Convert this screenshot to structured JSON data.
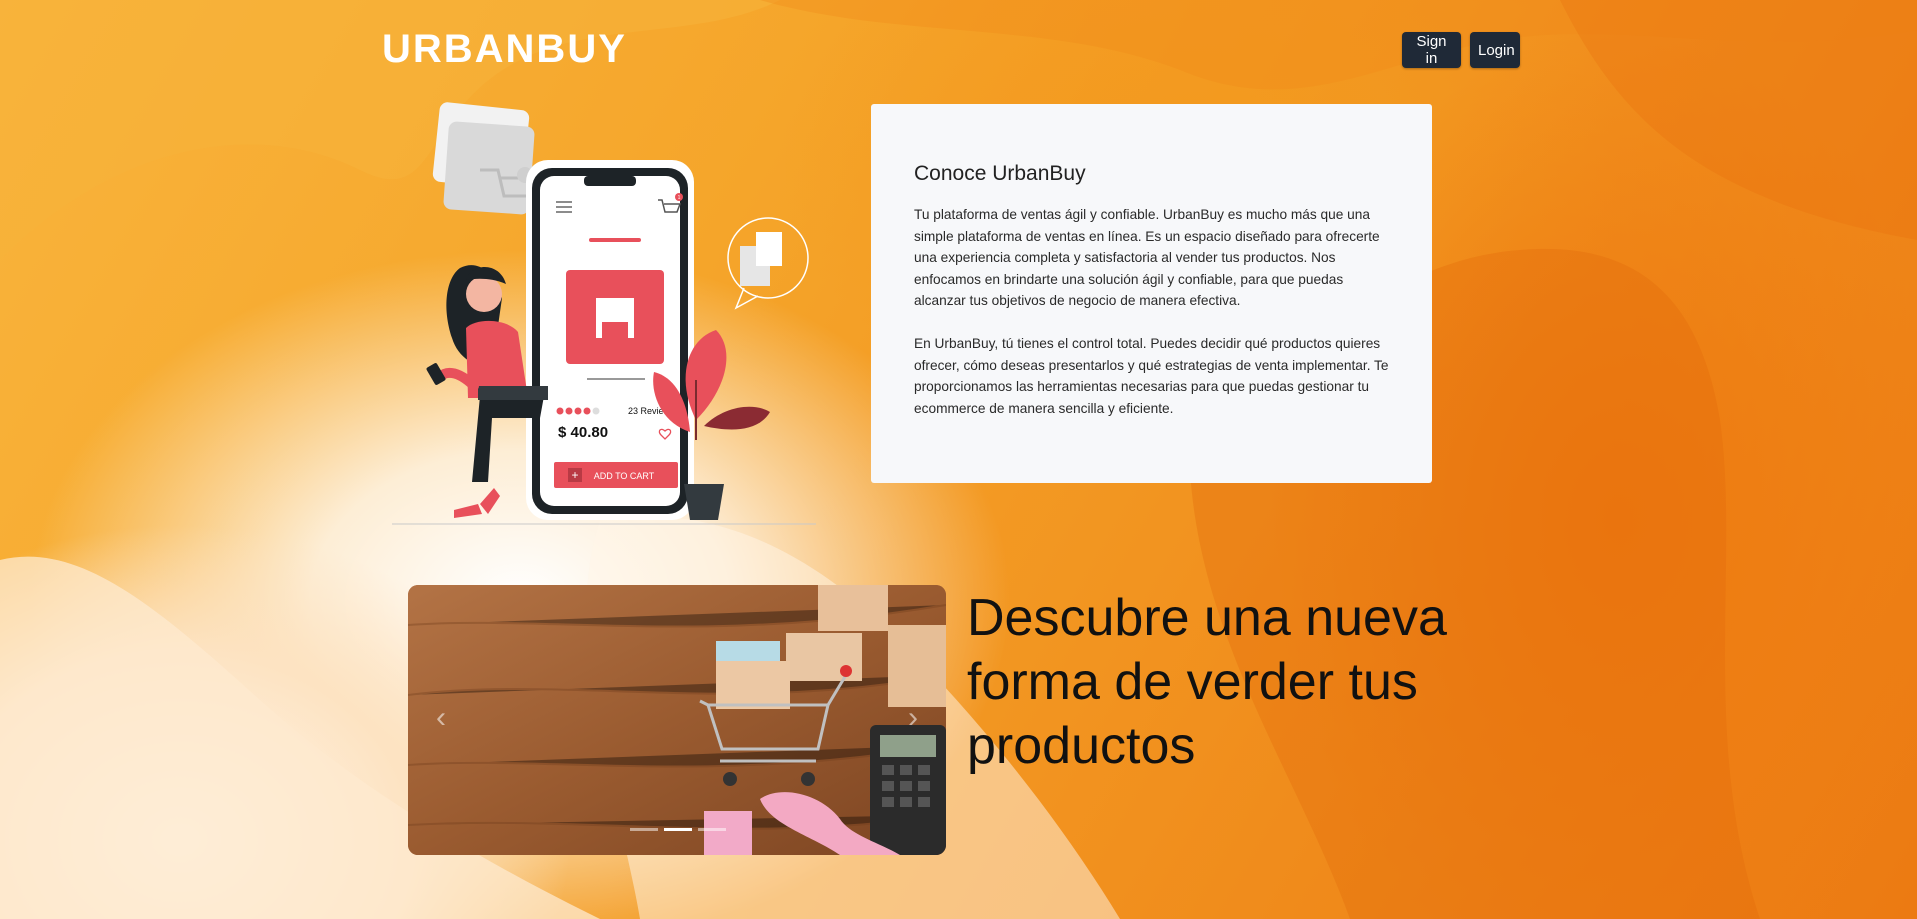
{
  "brand": {
    "logo_text": "URBANBUY"
  },
  "header": {
    "signin_label": "Sign in",
    "login_label": "Login"
  },
  "illustration": {
    "reviews_text": "23 Reviews",
    "price": "$ 40.80",
    "add_to_cart_label": "ADD TO CART",
    "cart_badge": "1"
  },
  "about": {
    "title": "Conoce UrbanBuy",
    "paragraph_1": "Tu plataforma de ventas ágil y confiable. UrbanBuy es mucho más que una simple plataforma de ventas en línea. Es un espacio diseñado para ofrecerte una experiencia completa y satisfactoria al vender tus productos. Nos enfocamos en brindarte una solución ágil y confiable, para que puedas alcanzar tus objetivos de negocio de manera efectiva.",
    "paragraph_2": "En UrbanBuy, tú tienes el control total. Puedes decidir qué productos quieres ofrecer, cómo deseas presentarlos y qué estrategias de venta implementar. Te proporcionamos las herramientas necesarias para que puedas gestionar tu ecommerce de manera sencilla y eficiente."
  },
  "carousel": {
    "prev_icon": "‹",
    "next_icon": "›",
    "slide_count": 3,
    "active_index": 1
  },
  "headline": "Descubre una nueva forma de verder tus productos",
  "colors": {
    "primary_orange": "#f29420",
    "button_dark": "#1f2937",
    "accent_red": "#e8505b",
    "card_bg": "#f7f8fa"
  }
}
